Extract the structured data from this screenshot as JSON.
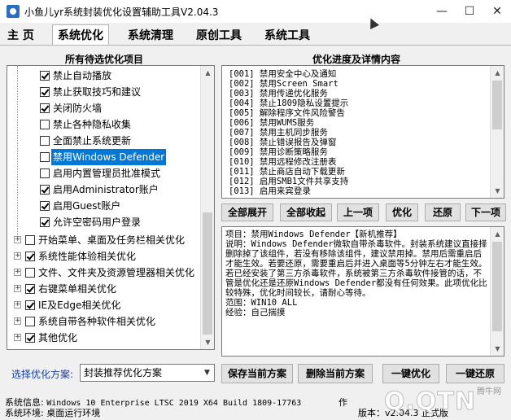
{
  "window": {
    "title": "小鱼儿yr系统封装优化设置辅助工具V2.04.3",
    "minimize_glyph": "—",
    "maximize_glyph": "☐",
    "close_glyph": "✕"
  },
  "tabs": [
    {
      "label": "主 页"
    },
    {
      "label": "系统优化"
    },
    {
      "label": "系统清理"
    },
    {
      "label": "原创工具"
    },
    {
      "label": "系统工具"
    }
  ],
  "left_panel": {
    "header": "所有待选优化项目",
    "items": [
      {
        "label": "禁止自动播放",
        "checked": true
      },
      {
        "label": "禁止获取技巧和建议",
        "checked": true
      },
      {
        "label": "关闭防火墙",
        "checked": true
      },
      {
        "label": "禁止各种隐私收集",
        "checked": false
      },
      {
        "label": "全面禁止系统更新",
        "checked": false
      },
      {
        "label": "禁用Windows Defender",
        "checked": false,
        "selected": true
      },
      {
        "label": "启用内置管理员批准模式",
        "checked": false
      },
      {
        "label": "启用Administrator账户",
        "checked": true
      },
      {
        "label": "启用Guest账户",
        "checked": true
      },
      {
        "label": "允许空密码用户登录",
        "checked": true
      }
    ],
    "groups": [
      {
        "label": "开始菜单、桌面及任务栏相关优化",
        "checked": false
      },
      {
        "label": "系统性能体验相关优化",
        "checked": true
      },
      {
        "label": "文件、文件夹及资源管理器相关优化",
        "checked": false
      },
      {
        "label": "右键菜单相关优化",
        "checked": true
      },
      {
        "label": "IE及Edge相关优化",
        "checked": true
      },
      {
        "label": "系统自带各种软件相关优化",
        "checked": false
      },
      {
        "label": "其他优化",
        "checked": true
      }
    ]
  },
  "right_panel": {
    "header": "优化进度及详情内容",
    "progress_items": [
      "[001] 禁用安全中心及通知",
      "[002] 禁用Screen Smart",
      "[003] 禁用传递优化服务",
      "[004] 禁止1809隐私设置提示",
      "[005] 解除程序文件风险警告",
      "[006] 禁用WUMS服务",
      "[007] 禁用主机同步服务",
      "[008] 禁止错误报告及弹窗",
      "[009] 禁用诊断策略服务",
      "[010] 禁用远程修改注册表",
      "[011] 禁止商店自动下载更新",
      "[012] 启用SMB1文件共享支持",
      "[013] 启用来宾登录"
    ],
    "buttons": {
      "expand_all": "全部展开",
      "collapse_all": "全部收起",
      "prev": "上一项",
      "optimize": "优化",
      "restore": "还原",
      "next": "下一项"
    },
    "detail_lines": [
      "项目：禁用Windows Defender【新机推荐】",
      "说明：Windows Defender微软自带杀毒软件。封装系统建议直接择删除掉了该组件，若没有移除该组件，建议禁用掉。禁用后需重启后才能生效。若要还原，需要重启后并进入桌面等5分钟左右才能生效。若已经安装了第三方杀毒软件，系统被第三方杀毒软件接管的话，不管是优化还是还原Windows Defender都没有任何效果。此项优化比较特殊，优化时间较长，请耐心等待。",
      "范围：WIN10 ALL",
      "经验：自己揣摸"
    ]
  },
  "bottom": {
    "scheme_label": "选择优化方案:",
    "scheme_value": "封装推荐优化方案",
    "save_scheme": "保存当前方案",
    "delete_scheme": "删除当前方案",
    "one_click_optimize": "一键优化",
    "one_click_restore": "一键还原",
    "sysinfo_label": "系统信息:",
    "sysinfo_value": "Windows 10 Enterprise LTSC 2019 X64 Build 1809-17763",
    "sysenv_label": "系统环境:",
    "sysenv_value": "桌面运行环境",
    "right_label_1": "作",
    "right_label_2": "版本：v2.04.3 正式版"
  },
  "watermark": {
    "text": "Q.QTN",
    "sub": "腾牛网"
  }
}
